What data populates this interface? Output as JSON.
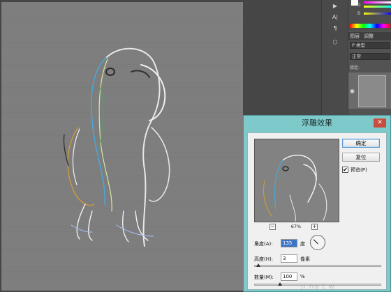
{
  "dialog": {
    "title": "浮雕效果",
    "close_label": "✕",
    "ok_label": "确定",
    "reset_label": "复位",
    "preview_label": "预览(P)",
    "preview_checked_mark": "✔",
    "zoom_out": "−",
    "zoom_in": "+",
    "zoom_value": "67%",
    "angle_label": "角度(A):",
    "angle_value": "135",
    "angle_unit": "度",
    "height_label": "高度(H):",
    "height_value": "3",
    "height_unit": "像素",
    "amount_label": "数量(M):",
    "amount_value": "100",
    "amount_unit": "%",
    "height_slider_fraction": 0.03,
    "amount_slider_fraction": 0.2,
    "watermark": "ji na t w"
  },
  "layers_panel": {
    "tab_layers": "图层",
    "tab_adjust": "调整",
    "filter_value": "P 类型",
    "blend_value": "正常",
    "lock_label": "锁定:"
  },
  "color_panel": {
    "g_label": "G",
    "b_label": "B"
  },
  "tools": {
    "tool_1": "▶",
    "tool_2": "A|",
    "tool_3": "¶",
    "tool_4": "⬡"
  },
  "colors": {
    "dialog_frame": "#7ecaca",
    "close_button": "#c94d3e",
    "canvas_gray": "#7f7f7f",
    "angle_highlight": "#3c74c7"
  }
}
